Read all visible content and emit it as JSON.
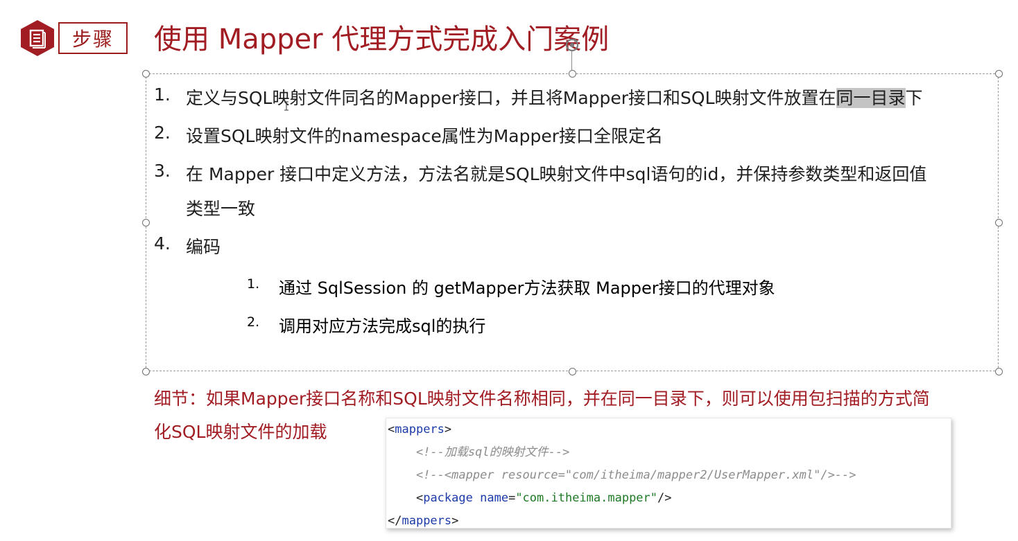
{
  "header": {
    "step_label": "步骤",
    "title": "使用 Mapper 代理方式完成入门案例"
  },
  "steps": [
    {
      "num": "1.",
      "pre": "定义与SQL映射文件同名的Mapper接口，并且将Mapper接口和SQL映射文件放置在",
      "highlight": "同一目录",
      "post": "下"
    },
    {
      "num": "2.",
      "text": "设置SQL映射文件的namespace属性为Mapper接口全限定名"
    },
    {
      "num": "3.",
      "line1": "在 Mapper 接口中定义方法，方法名就是SQL映射文件中sql语句的id，并保持参数类型和返回值",
      "line2": "类型一致"
    },
    {
      "num": "4.",
      "text": "编码"
    }
  ],
  "substeps": [
    {
      "num": "1.",
      "text": "通过  SqlSession 的  getMapper方法获取  Mapper接口的代理对象"
    },
    {
      "num": "2.",
      "text": "调用对应方法完成sql的执行"
    }
  ],
  "detail": {
    "line1": "细节：如果Mapper接口名称和SQL映射文件名称相同，并在同一目录下，则可以使用包扫描的方式简",
    "line2": "化SQL映射文件的加载"
  },
  "code": {
    "open_tag": "mappers",
    "comment1": "<!--加载sql的映射文件-->",
    "comment2": "<!--<mapper resource=\"com/itheima/mapper2/UserMapper.xml\"/>-->",
    "package_tag": "package",
    "package_attr": "name",
    "package_value": "\"com.itheima.mapper\"",
    "close_tag": "mappers"
  },
  "colors": {
    "accent": "#a11d23",
    "highlight": "#c4c4c4",
    "code_tag": "#1c3aa9",
    "code_value": "#1f7a26",
    "code_comment": "#8c8c8c"
  },
  "icons": {
    "step_badge": "document-icon",
    "rotate": "rotate-handle-icon",
    "cursor": "text-cursor-icon"
  }
}
